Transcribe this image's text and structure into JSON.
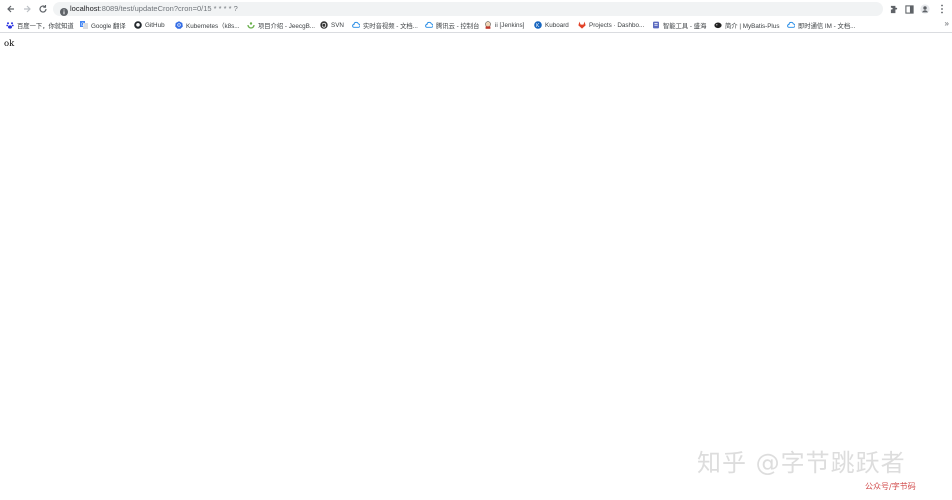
{
  "browser": {
    "url_host": "localhost",
    "url_rest": ":8089/test/updateCron?cron=0/15 * * * * ?",
    "bookmarks": [
      {
        "label": "百度一下，你就知道",
        "icon": "baidu-icon",
        "color": "#2932e1"
      },
      {
        "label": "Google 翻译",
        "icon": "google-translate-icon",
        "color": "#4285f4"
      },
      {
        "label": "GitHub",
        "icon": "github-icon",
        "color": "#24292e"
      },
      {
        "label": "Kubernetes（k8s...",
        "icon": "kubernetes-icon",
        "color": "#326ce5"
      },
      {
        "label": "项目介绍 - JeecgB...",
        "icon": "jeecg-icon",
        "color": "#6ab04c"
      },
      {
        "label": "SVN",
        "icon": "svn-icon",
        "color": "#333333"
      },
      {
        "label": "实时音视频 - 文档...",
        "icon": "cloud-icon",
        "color": "#1e88e5"
      },
      {
        "label": "腾讯云 - 控制台",
        "icon": "tencent-cloud-icon",
        "color": "#1e88e5"
      },
      {
        "label": "ii [Jenkins]",
        "icon": "jenkins-icon",
        "color": "#c0392b"
      },
      {
        "label": "Kuboard",
        "icon": "kuboard-icon",
        "color": "#1565c0"
      },
      {
        "label": "Projects · Dashbo...",
        "icon": "gitlab-icon",
        "color": "#e24329"
      },
      {
        "label": "智能工具 - 盛海",
        "icon": "tool-icon",
        "color": "#5b6abf"
      },
      {
        "label": "简介 | MyBatis-Plus",
        "icon": "mybatis-plus-icon",
        "color": "#222222"
      },
      {
        "label": "即时通信 IM - 文档...",
        "icon": "cloud-icon",
        "color": "#1e88e5"
      }
    ]
  },
  "page": {
    "body_text": "ok"
  },
  "watermark": {
    "text": "知乎 @字节跳跃者",
    "small_text": "公众号/字节码"
  }
}
